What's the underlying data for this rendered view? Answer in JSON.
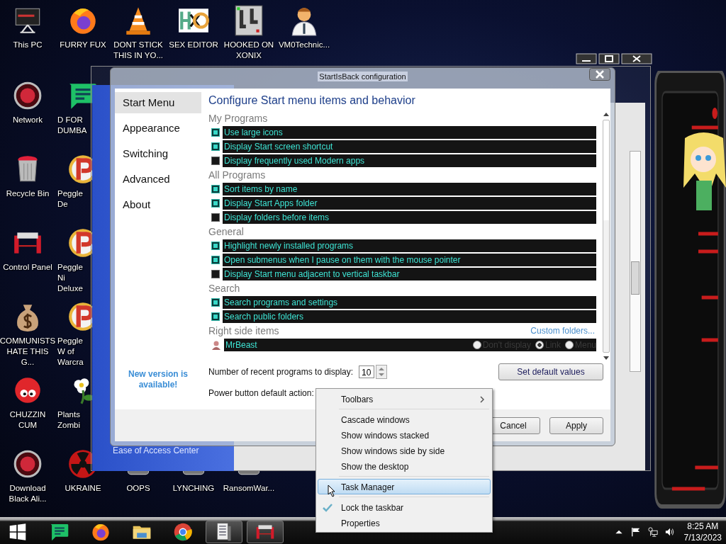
{
  "desktop": {
    "top_row": [
      {
        "label": "This PC",
        "kind": "computer"
      },
      {
        "label": "FURRY FUX",
        "kind": "browser"
      },
      {
        "label": "DONT STICK THIS IN YO...",
        "kind": "cone"
      },
      {
        "label": "SEX EDITOR",
        "kind": "hex"
      },
      {
        "label": "HOOKED ON XONIX",
        "kind": "maze"
      },
      {
        "label": "VM0Technic...",
        "kind": "doctor"
      }
    ],
    "left_column": [
      {
        "label": "Network",
        "kind": "orb"
      },
      {
        "label": "Recycle Bin",
        "kind": "bin"
      },
      {
        "label": "Control Panel",
        "kind": "device"
      },
      {
        "label": "COMMUNISTS HATE THIS G...",
        "kind": "moneybag"
      },
      {
        "label": "CHUZZIN CUM",
        "kind": "fuzzball"
      },
      {
        "label": "Download Black Ali...",
        "kind": "orb"
      }
    ],
    "second_column": [
      {
        "label": "D FOR DUMBA",
        "kind": "chat"
      },
      {
        "label": "Peggle De",
        "kind": "peggle"
      },
      {
        "label": "Peggle Ni Deluxe",
        "kind": "peggle"
      },
      {
        "label": "Peggle W of Warcra",
        "kind": "peggle"
      },
      {
        "label": "Plants Zombi",
        "kind": "flower"
      }
    ],
    "bottom_row": [
      {
        "label": "UKRAINE",
        "kind": "radiation"
      },
      {
        "label": "OOPS",
        "kind": "generic"
      },
      {
        "label": "LYNCHING",
        "kind": "generic"
      },
      {
        "label": "RansomWar...",
        "kind": "generic"
      }
    ]
  },
  "background_window": {
    "footer_link": "Ease of Access Center"
  },
  "dialog": {
    "title": "StartIsBack configuration",
    "nav": [
      {
        "label": "Start Menu",
        "selected": true
      },
      {
        "label": "Appearance",
        "selected": false
      },
      {
        "label": "Switching",
        "selected": false
      },
      {
        "label": "Advanced",
        "selected": false
      },
      {
        "label": "About",
        "selected": false
      }
    ],
    "update_notice": "New version is available!",
    "heading": "Configure Start menu items and behavior",
    "sections": [
      {
        "title": "My Programs",
        "items": [
          {
            "label": "Use large icons",
            "checked": true
          },
          {
            "label": "Display Start screen shortcut",
            "checked": true
          },
          {
            "label": "Display frequently used Modern apps",
            "checked": false
          }
        ]
      },
      {
        "title": "All Programs",
        "items": [
          {
            "label": "Sort items by name",
            "checked": true
          },
          {
            "label": "Display Start Apps folder",
            "checked": true
          },
          {
            "label": "Display folders before items",
            "checked": false
          }
        ]
      },
      {
        "title": "General",
        "items": [
          {
            "label": "Highlight newly installed programs",
            "checked": true
          },
          {
            "label": "Open submenus when I pause on them with the mouse pointer",
            "checked": true
          },
          {
            "label": "Display Start menu adjacent to vertical taskbar",
            "checked": false
          }
        ]
      },
      {
        "title": "Search",
        "items": [
          {
            "label": "Search programs and settings",
            "checked": true
          },
          {
            "label": "Search public folders",
            "checked": true
          }
        ]
      }
    ],
    "right_side": {
      "title": "Right side items",
      "link": "Custom folders...",
      "items": [
        {
          "label": "MrBeast",
          "options": [
            {
              "label": "Don't display",
              "selected": false
            },
            {
              "label": "Link",
              "selected": true
            },
            {
              "label": "Menu",
              "selected": false
            }
          ]
        }
      ]
    },
    "recent_programs": {
      "label": "Number of recent programs to display:",
      "value": "10"
    },
    "set_default_button": "Set default values",
    "power_action": {
      "label": "Power button default action:"
    },
    "footer_buttons": [
      "Cancel",
      "Apply"
    ]
  },
  "context_menu": [
    {
      "kind": "submenu",
      "label": "Toolbars",
      "selected": false,
      "checked": false
    },
    {
      "kind": "separator"
    },
    {
      "kind": "item",
      "label": "Cascade windows",
      "selected": false,
      "checked": false
    },
    {
      "kind": "item",
      "label": "Show windows stacked",
      "selected": false,
      "checked": false
    },
    {
      "kind": "item",
      "label": "Show windows side by side",
      "selected": false,
      "checked": false
    },
    {
      "kind": "item",
      "label": "Show the desktop",
      "selected": false,
      "checked": false
    },
    {
      "kind": "separator"
    },
    {
      "kind": "item",
      "label": "Task Manager",
      "selected": true,
      "checked": false
    },
    {
      "kind": "separator"
    },
    {
      "kind": "item",
      "label": "Lock the taskbar",
      "selected": false,
      "checked": true
    },
    {
      "kind": "item",
      "label": "Properties",
      "selected": false,
      "checked": false
    }
  ],
  "taskbar": {
    "pinned": [
      {
        "kind": "chat",
        "open": false
      },
      {
        "kind": "browser",
        "open": false
      },
      {
        "kind": "folder",
        "open": false
      },
      {
        "kind": "chrome",
        "open": false
      },
      {
        "kind": "list",
        "open": true
      },
      {
        "kind": "device",
        "open": true
      }
    ],
    "clock": {
      "time": "8:25 AM",
      "date": "7/13/2023"
    }
  }
}
